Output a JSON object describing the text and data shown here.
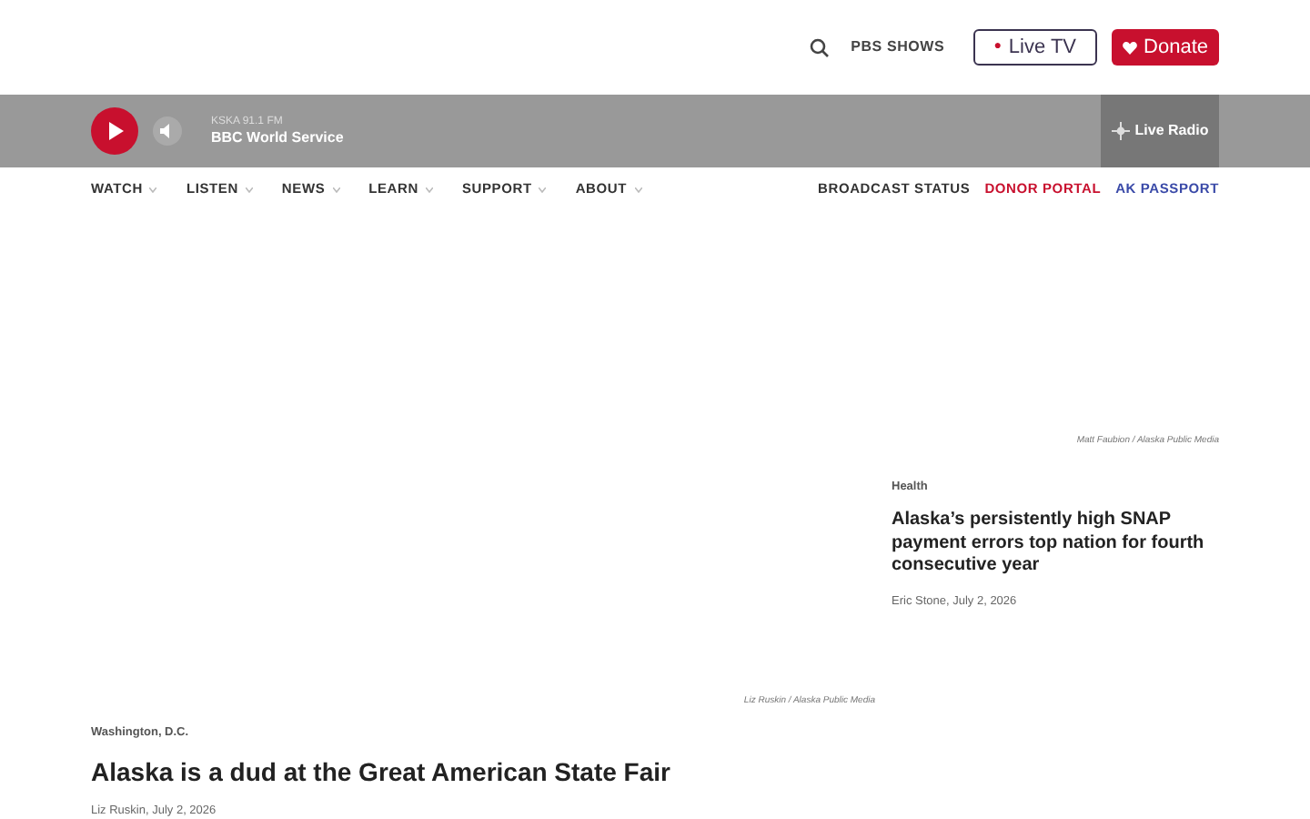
{
  "header": {
    "shows_link": "PBS SHOWS",
    "live_tv": {
      "dot": "●",
      "label": "Live TV"
    },
    "donate": {
      "label": "Donate"
    }
  },
  "player": {
    "station": "KSKA 91.1 FM",
    "program": "BBC World Service",
    "live_radio": {
      "label": "Live Radio",
      "selected": true
    }
  },
  "nav": {
    "items": [
      {
        "label": "WATCH"
      },
      {
        "label": "LISTEN"
      },
      {
        "label": "NEWS"
      },
      {
        "label": "LEARN"
      },
      {
        "label": "SUPPORT"
      },
      {
        "label": "ABOUT"
      }
    ],
    "links": [
      {
        "label": "BROADCAST STATUS",
        "color": "#333333"
      },
      {
        "label": "DONOR PORTAL",
        "color": "#c8102e"
      },
      {
        "label": "AK PASSPORT",
        "color": "#3a4aa8"
      }
    ]
  },
  "stories": [
    {
      "credit": "Liz Ruskin  /  Alaska Public Media",
      "section": "Washington, D.C.",
      "headline": "Alaska is a dud at the Great American State Fair",
      "byline": "Liz Ruskin, July 2, 2026"
    },
    {
      "credit": "Matt Faubion  /  Alaska Public Media",
      "section": "Health",
      "headline": "Alaska’s persistently high SNAP payment errors top nation for fourth consecutive year",
      "byline": "Eric Stone, July 2, 2026"
    }
  ]
}
